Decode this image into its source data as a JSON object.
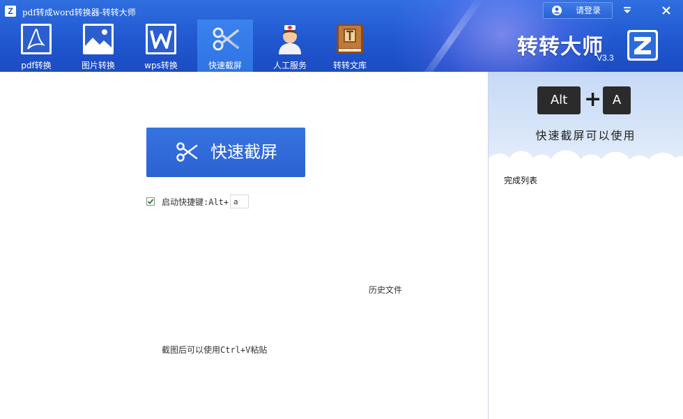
{
  "window": {
    "title": "pdf转成word转换器-转转大师",
    "logo_letter": "Z",
    "login_label": "请登录",
    "minimize_glyph": "▾",
    "close_glyph": "✕"
  },
  "nav": {
    "items": [
      {
        "label": "pdf转换",
        "icon": "pdf-icon"
      },
      {
        "label": "图片转换",
        "icon": "image-icon"
      },
      {
        "label": "wps转换",
        "icon": "wps-icon"
      },
      {
        "label": "快速截屏",
        "icon": "scissors-icon",
        "active": true
      },
      {
        "label": "人工服务",
        "icon": "nurse-icon"
      },
      {
        "label": "转转文库",
        "icon": "book-icon"
      }
    ]
  },
  "brand": {
    "name": "转转大师",
    "version": "V3.3",
    "logo_letter": "Z"
  },
  "main": {
    "capture_button_label": "快速截屏",
    "hotkey_enabled": true,
    "hotkey_label": "启动快捷键:Alt+",
    "hotkey_value": "a",
    "history_link": "历史文件",
    "paste_tip": "截图后可以使用Ctrl+V粘贴"
  },
  "panel": {
    "key1": "Alt",
    "key_plus": "+",
    "key2": "A",
    "banner_text": "快速截屏可以使用",
    "done_list_title": "完成列表"
  },
  "colors": {
    "header_blue": "#2158d0",
    "button_blue": "#2f68d8",
    "banner_light": "#d7e5f8"
  }
}
